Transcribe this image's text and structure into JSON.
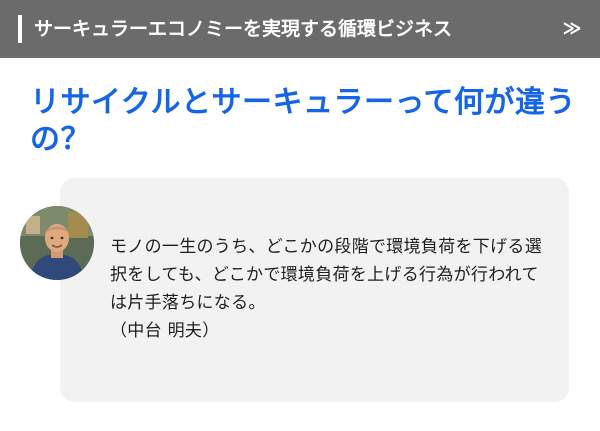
{
  "header": {
    "title": "サーキュラーエコノミーを実現する循環ビジネス",
    "next_label": "≫",
    "background_color": "#6b6b6b",
    "next_icon": "double-chevron-right-icon"
  },
  "headline": {
    "text": "リサイクルとサーキュラーって何が違うの？",
    "color": "#1565e6"
  },
  "quote": {
    "text": "モノの一生のうち、どこかの段階で環境負荷を下げる選択をしても、どこかで環境負荷を上げる行為が行われては片手落ちになる。",
    "author": "（中台 明夫）",
    "card_color": "#f2f2f2"
  },
  "avatar": {
    "icon": "person-photo"
  }
}
